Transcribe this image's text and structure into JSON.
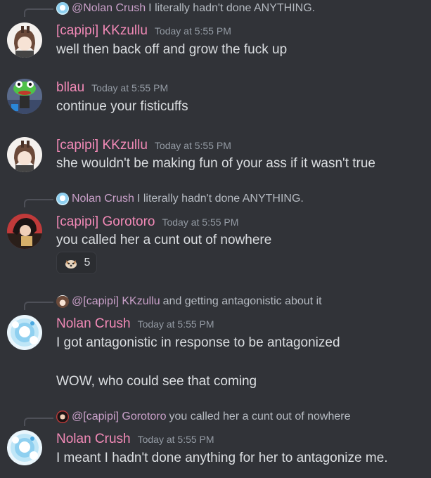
{
  "colors": {
    "background": "#313338",
    "username": "#f28ab7",
    "reply_name": "#c9a0c9",
    "timestamp": "#949ba4",
    "text": "#dbdee1"
  },
  "messages": [
    {
      "reply": {
        "name": "@Nolan Crush",
        "text": "I literally hadn't done ANYTHING.",
        "icon": "nolan-avatar-icon"
      },
      "username": "[capipi] KKzullu",
      "timestamp": "Today at 5:55 PM",
      "avatar": "kkzullu-avatar",
      "lines": [
        "well then back off and grow the fuck up"
      ]
    },
    {
      "username": "bllau",
      "timestamp": "Today at 5:55 PM",
      "avatar": "bllau-avatar",
      "lines": [
        "continue your fisticuffs"
      ]
    },
    {
      "username": "[capipi] KKzullu",
      "timestamp": "Today at 5:55 PM",
      "avatar": "kkzullu-avatar",
      "lines": [
        "she wouldn't be making fun of your ass if it wasn't true"
      ]
    },
    {
      "reply": {
        "name": "Nolan Crush",
        "text": "I literally hadn't done ANYTHING.",
        "icon": "nolan-avatar-icon"
      },
      "username": "[capipi] Gorotoro",
      "timestamp": "Today at 5:55 PM",
      "avatar": "gorotoro-avatar",
      "lines": [
        "you called her a cunt out of nowhere"
      ],
      "reaction": {
        "emoji": "dog-emoji",
        "count": "5"
      }
    },
    {
      "reply": {
        "name": "@[capipi] KKzullu",
        "text": "and getting antagonistic about it",
        "icon": "kkzullu-avatar-icon"
      },
      "username": "Nolan Crush",
      "timestamp": "Today at 5:55 PM",
      "avatar": "nolan-avatar",
      "lines": [
        "I got antagonistic in response to be antagonized",
        "WOW, who could see that coming"
      ]
    },
    {
      "reply": {
        "name": "@[capipi] Gorotoro",
        "text": "you called her a cunt out of nowhere",
        "icon": "gorotoro-avatar-icon"
      },
      "username": "Nolan Crush",
      "timestamp": "Today at 5:55 PM",
      "avatar": "nolan-avatar",
      "lines": [
        "I meant I hadn't done anything for her to antagonize me."
      ]
    }
  ]
}
